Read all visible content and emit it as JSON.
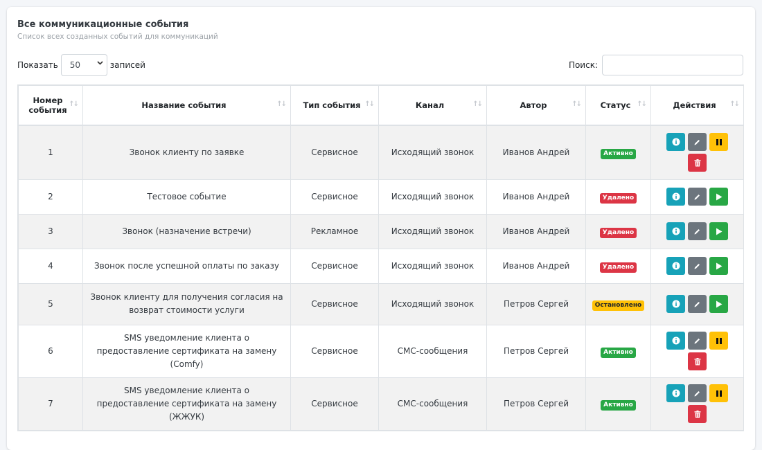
{
  "card": {
    "title": "Все коммуникационные события",
    "subtitle": "Список всех созданных событий для коммуникаций"
  },
  "controls": {
    "show_label": "Показать",
    "show_value": "50",
    "entries_label": "записей",
    "search_label": "Поиск:",
    "search_value": ""
  },
  "table": {
    "headers": [
      "Номер события",
      "Название события",
      "Тип события",
      "Канал",
      "Автор",
      "Статус",
      "Действия"
    ],
    "rows": [
      {
        "id": "1",
        "name": "Звонок клиенту по заявке",
        "type": "Сервисное",
        "channel": "Исходящий звонок",
        "author": "Иванов Андрей",
        "status": "Активно",
        "status_color": "#28a745"
      },
      {
        "id": "2",
        "name": "Тестовое событие",
        "type": "Сервисное",
        "channel": "Исходящий звонок",
        "author": "Иванов Андрей",
        "status": "Удалено",
        "status_color": "#dc3545"
      },
      {
        "id": "3",
        "name": "Звонок (назначение встречи)",
        "type": "Рекламное",
        "channel": "Исходящий звонок",
        "author": "Иванов Андрей",
        "status": "Удалено",
        "status_color": "#dc3545"
      },
      {
        "id": "4",
        "name": "Звонок после успешной оплаты по заказу",
        "type": "Сервисное",
        "channel": "Исходящий звонок",
        "author": "Иванов Андрей",
        "status": "Удалено",
        "status_color": "#dc3545"
      },
      {
        "id": "5",
        "name": "Звонок клиенту для получения согласия на возврат стоимости услуги",
        "type": "Сервисное",
        "channel": "Исходящий звонок",
        "author": "Петров Сергей",
        "status": "Остановлено",
        "status_color": "#ffc107"
      },
      {
        "id": "6",
        "name": "SMS уведомление клиента о предоставление сертификата на замену (Comfy)",
        "type": "Сервисное",
        "channel": "СМС-сообщения",
        "author": "Петров Сергей",
        "status": "Активно",
        "status_color": "#28a745"
      },
      {
        "id": "7",
        "name": "SMS уведомление клиента о предоставление сертификата на замену (ЖЖУК)",
        "type": "Сервисное",
        "channel": "СМС-сообщения",
        "author": "Петров Сергей",
        "status": "Активно",
        "status_color": "#28a745"
      }
    ]
  },
  "icons": {
    "sort": "sort-arrows-icon",
    "info": "info-icon",
    "edit": "pencil-icon",
    "pause": "pause-icon",
    "play": "play-icon",
    "delete": "trash-icon"
  }
}
